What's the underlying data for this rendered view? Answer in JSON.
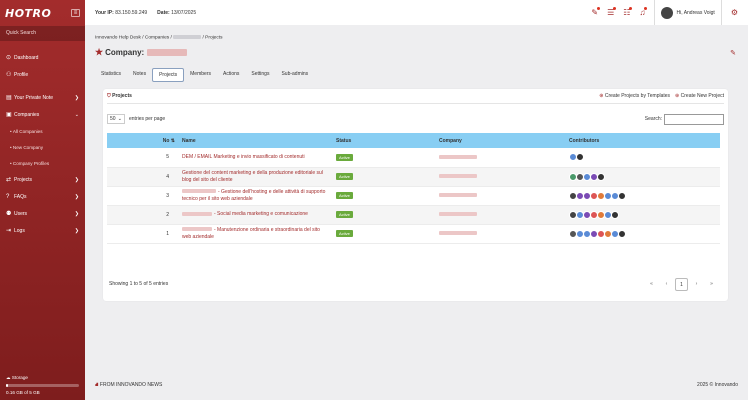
{
  "sidebar": {
    "logo": "HOTRO",
    "quick_search": "Quick Search",
    "items": [
      {
        "label": "Dashboard",
        "icon": "⊙"
      },
      {
        "label": "Profile",
        "icon": "⚇"
      }
    ],
    "items2": [
      {
        "label": "Your Private Note",
        "icon": "▤"
      },
      {
        "label": "Companies",
        "icon": "▣"
      }
    ],
    "sub": [
      "All Companies",
      "New Company",
      "Company Profiles"
    ],
    "items3": [
      {
        "label": "Projects",
        "icon": "⇄"
      },
      {
        "label": "FAQs",
        "icon": "?"
      },
      {
        "label": "Users",
        "icon": "⚉"
      },
      {
        "label": "Logs",
        "icon": "⇥"
      }
    ],
    "storage_label": "Storage",
    "storage_value": "0.16 GB of 5 GB",
    "storage_fraction": 0.032
  },
  "header": {
    "ip_label": "Your IP:",
    "ip": "83.150.59.249",
    "date_label": "Date:",
    "date": "13/07/2025",
    "user": "Hi, Andreas Voigt"
  },
  "breadcrumb": {
    "a": "Innovando Help Desk",
    "b": "Companies",
    "d": "Projects"
  },
  "page": {
    "title": "Company:"
  },
  "tabs": [
    "Statistics",
    "Notes",
    "Projects",
    "Members",
    "Actions",
    "Settings",
    "Sub-admins"
  ],
  "card": {
    "title": "Projects",
    "link1": "Create Projects by Templates",
    "link2": "Create New Project",
    "entries_value": "50",
    "entries_label": "entries per page",
    "search_label": "Search:",
    "showing": "Showing 1 to 5 of 5 entries",
    "page": "1"
  },
  "table": {
    "headers": [
      "No",
      "Name",
      "Status",
      "Company",
      "Contributors"
    ],
    "rows": [
      {
        "no": "5",
        "name": "DEM / EMAIL Marketing e invio massificato di contenuti",
        "status": "Active",
        "avatars": [
          "#5a8bd6",
          "#333"
        ]
      },
      {
        "no": "4",
        "name": "Gestione del content marketing e della produzione editoriale sul blog del sito del cliente",
        "status": "Active",
        "avatars": [
          "#4a9a6a",
          "#555",
          "#5a8bd6",
          "#7b4bb5",
          "#333"
        ]
      },
      {
        "no": "3",
        "name": "- Gestione dell'hosting e delle attività di supporto tecnico per il sito web aziendale",
        "status": "Active",
        "avatars": [
          "#444",
          "#7b4bb5",
          "#7b4bb5",
          "#d55",
          "#e07b3a",
          "#5a8bd6",
          "#5a8bd6",
          "#333"
        ]
      },
      {
        "no": "2",
        "name": "- Social media marketing e comunicazione",
        "status": "Active",
        "avatars": [
          "#444",
          "#5a8bd6",
          "#7b4bb5",
          "#d55",
          "#e07b3a",
          "#5a8bd6",
          "#333"
        ]
      },
      {
        "no": "1",
        "name": "- Manutenzione ordinaria e straordinaria del sito web aziendale",
        "status": "Active",
        "avatars": [
          "#555",
          "#5a8bd6",
          "#5a8bd6",
          "#7b4bb5",
          "#d55",
          "#e07b3a",
          "#5a8bd6",
          "#333"
        ]
      }
    ]
  },
  "footer": {
    "news": "FROM INNOVANDO NEWS",
    "copy": "2025 © Innovando"
  }
}
